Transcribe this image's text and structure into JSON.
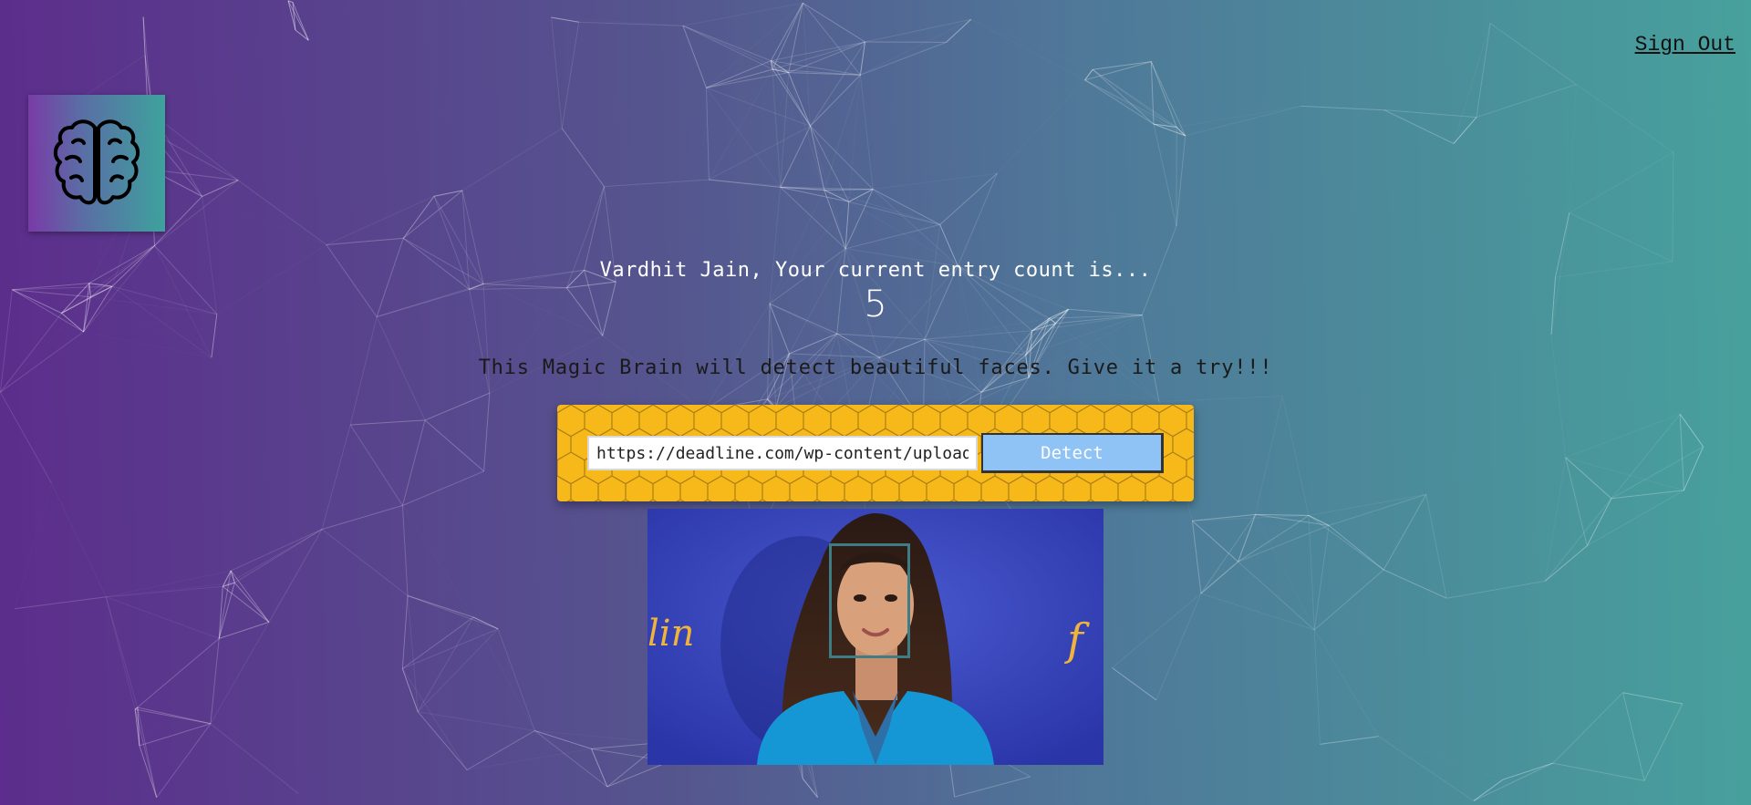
{
  "nav": {
    "sign_out_label": "Sign Out"
  },
  "logo": {
    "icon": "brain-icon"
  },
  "rank": {
    "greeting": "Vardhit Jain, Your current entry count is...",
    "count": "5"
  },
  "tagline": "This Magic Brain will detect beautiful faces. Give it a try!!!",
  "form": {
    "url_value": "https://deadline.com/wp-content/uploads",
    "detect_label": "Detect"
  },
  "result": {
    "photo_backdrop_text_left": "lin",
    "photo_backdrop_text_right": "f",
    "face_box_count": 1
  },
  "colors": {
    "gradient_start": "#5c2d8c",
    "gradient_end": "#47a19c",
    "form_panel": "#f7b819",
    "detect_button": "#8fc3f5",
    "face_box": "#3f7d86"
  }
}
